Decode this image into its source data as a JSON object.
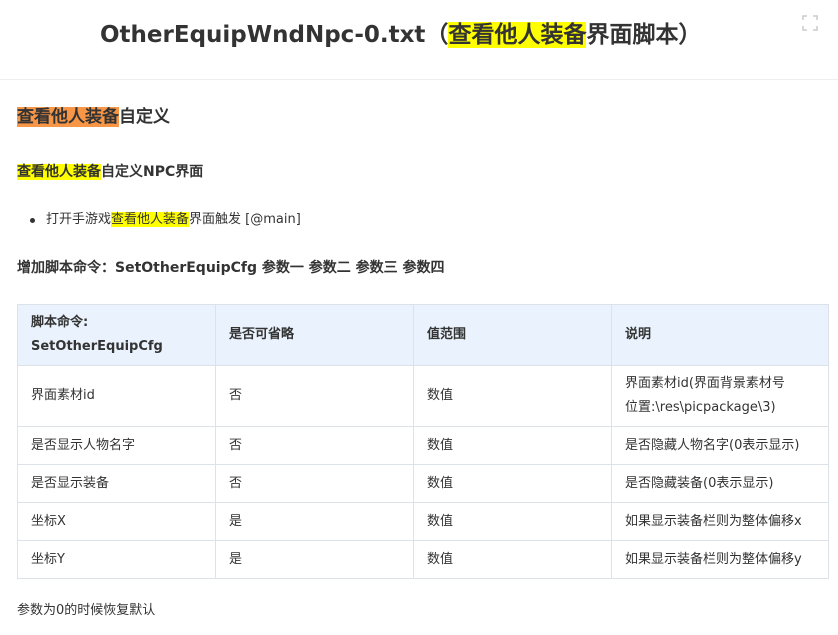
{
  "header": {
    "title_prefix": "OtherEquipWndNpc-0.txt（",
    "title_highlight": "查看他人装备",
    "title_suffix": "界面脚本）",
    "expand_icon": "expand-icon"
  },
  "section": {
    "heading_highlight": "查看他人装备",
    "heading_rest": "自定义",
    "subheading_highlight": "查看他人装备",
    "subheading_rest": "自定义NPC界面",
    "bullets": [
      {
        "prefix": "打开手游戏",
        "highlight": "查看他人装备",
        "suffix": "界面触发 [@main]"
      }
    ],
    "command_line": "增加脚本命令：SetOtherEquipCfg 参数一 参数二 参数三 参数四"
  },
  "table": {
    "headers": [
      "脚本命令:",
      "SetOtherEquipCfg",
      "是否可省略",
      "值范围",
      "说明"
    ],
    "rows": [
      {
        "name": "界面素材id",
        "optional": "否",
        "range": "数值",
        "desc": [
          "界面素材id(界面背景素材号",
          "位置:\\res\\picpackage\\3)"
        ]
      },
      {
        "name": "是否显示人物名字",
        "optional": "否",
        "range": "数值",
        "desc": [
          "是否隐藏人物名字(0表示显示)"
        ]
      },
      {
        "name": "是否显示装备",
        "optional": "否",
        "range": "数值",
        "desc": [
          "是否隐藏装备(0表示显示)"
        ]
      },
      {
        "name": "坐标X",
        "optional": "是",
        "range": "数值",
        "desc": [
          "如果显示装备栏则为整体偏移x"
        ]
      },
      {
        "name": "坐标Y",
        "optional": "是",
        "range": "数值",
        "desc": [
          "如果显示装备栏则为整体偏移y"
        ]
      }
    ]
  },
  "footer": {
    "note": "参数为0的时候恢复默认"
  },
  "colors": {
    "highlight_yellow": "#ffff00",
    "highlight_orange": "#f79646",
    "table_header_bg": "#eaf3fd"
  }
}
